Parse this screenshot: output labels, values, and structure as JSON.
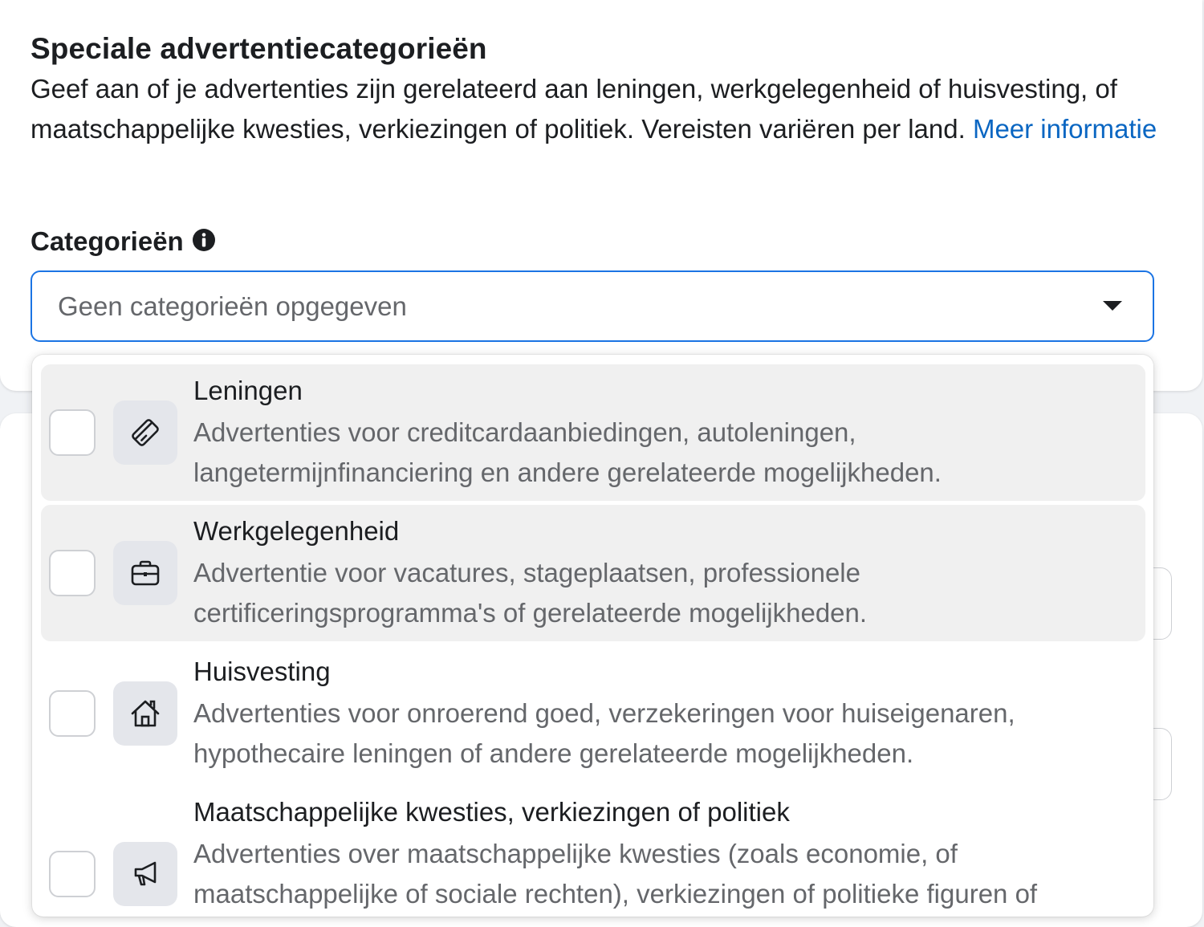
{
  "section": {
    "title": "Speciale advertentiecategorieën",
    "description": "Geef aan of je advertenties zijn gerelateerd aan leningen, werkgelegenheid of huisvesting, of maatschappelijke kwesties, verkiezingen of politiek. Vereisten variëren per land.",
    "learn_more": "Meer informatie"
  },
  "categories": {
    "label": "Categorieën",
    "info_icon": "info-circle-icon",
    "placeholder": "Geen categorieën opgegeven"
  },
  "options": [
    {
      "title": "Leningen",
      "description": "Advertenties voor creditcardaanbiedingen, autoleningen, langetermijnfinanciering en andere gerelateerde mogelijkheden.",
      "icon": "credit-card-icon",
      "checked": false
    },
    {
      "title": "Werkgelegenheid",
      "description": "Advertentie voor vacatures, stageplaatsen, professionele certificeringsprogramma's of gerelateerde mogelijkheden.",
      "icon": "briefcase-icon",
      "checked": false
    },
    {
      "title": "Huisvesting",
      "description": "Advertenties voor onroerend goed, verzekeringen voor huiseigenaren, hypothecaire leningen of andere gerelateerde mogelijkheden.",
      "icon": "house-icon",
      "checked": false
    },
    {
      "title": "Maatschappelijke kwesties, verkiezingen of politiek",
      "description": "Advertenties over maatschappelijke kwesties (zoals economie, of maatschappelijke of sociale rechten), verkiezingen of politieke figuren of",
      "icon": "megaphone-icon",
      "checked": false
    }
  ],
  "colors": {
    "link": "#0a66c2",
    "focus_border": "#1b74e4",
    "hover_bg": "#f0f0f0"
  }
}
